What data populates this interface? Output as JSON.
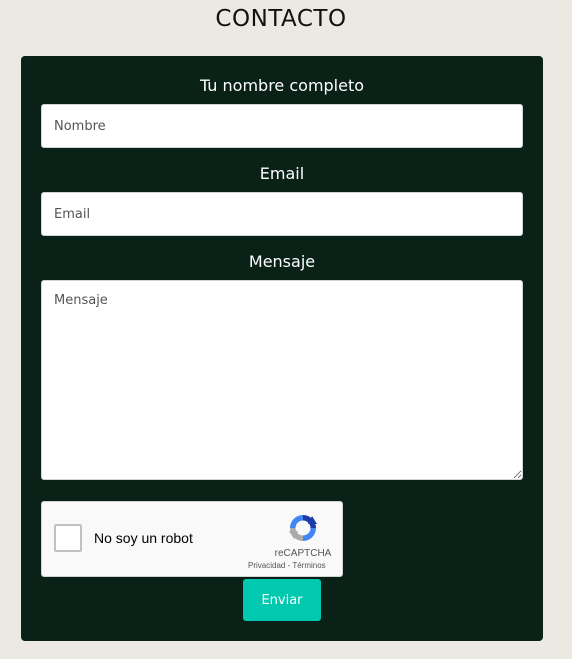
{
  "page": {
    "title": "CONTACTO"
  },
  "form": {
    "name_label": "Tu nombre completo",
    "name_placeholder": "Nombre",
    "email_label": "Email",
    "email_placeholder": "Email",
    "message_label": "Mensaje",
    "message_placeholder": "Mensaje",
    "submit_label": "Enviar"
  },
  "recaptcha": {
    "checkbox_label": "No soy un robot",
    "brand": "reCAPTCHA",
    "privacy_link": "Privacidad",
    "separator": " - ",
    "terms_link": "Términos",
    "checked": false
  },
  "colors": {
    "page_background": "#ebe9e2",
    "panel_background": "#0a2118",
    "button_accent": "#00c9b0"
  }
}
